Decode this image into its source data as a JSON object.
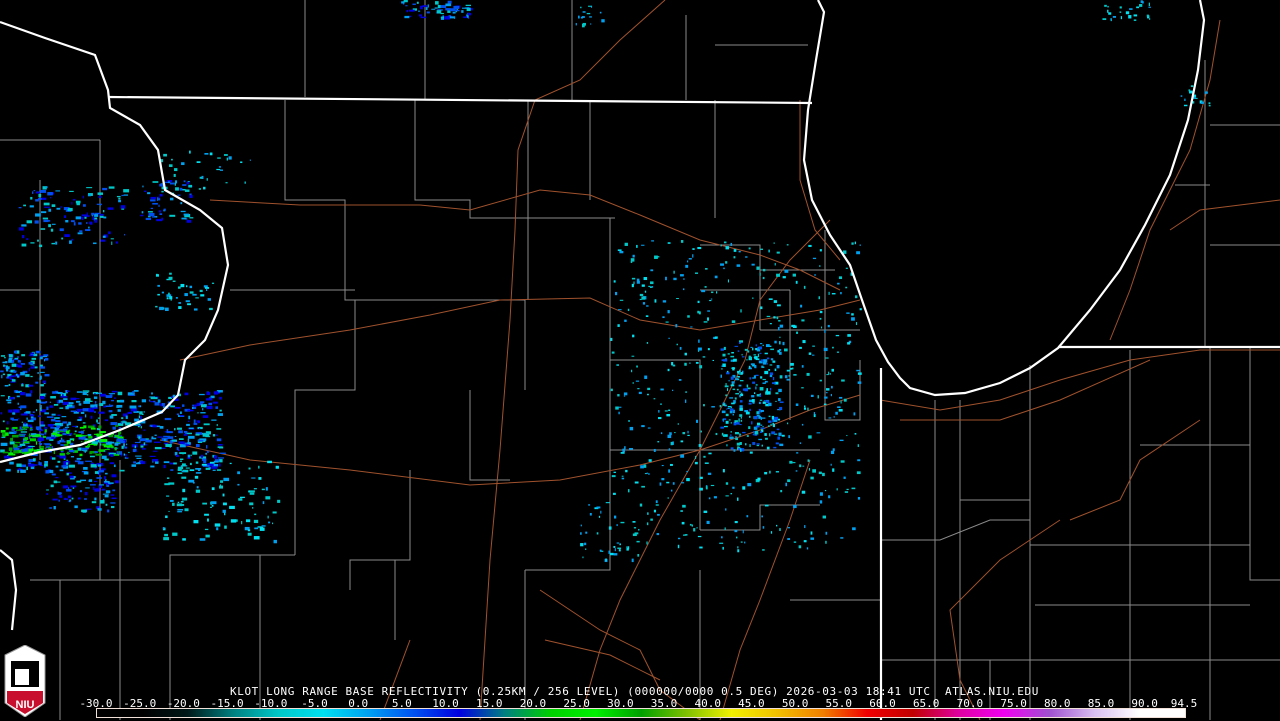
{
  "product": {
    "title": "KLOT LONG RANGE BASE REFLECTIVITY (0.25KM / 256 LEVEL) (000000/0000 0.5 DEG) 2026-03-03 18:41 UTC  ATLAS.NIU.EDU"
  },
  "colorbar": {
    "ticks": [
      "-30.0",
      "-25.0",
      "-20.0",
      "-15.0",
      "-10.0",
      "-5.0",
      "0.0",
      "5.0",
      "10.0",
      "15.0",
      "20.0",
      "25.0",
      "30.0",
      "35.0",
      "40.0",
      "45.0",
      "50.0",
      "55.0",
      "60.0",
      "65.0",
      "70.0",
      "75.0",
      "80.0",
      "85.0",
      "90.0",
      "94.5"
    ],
    "min": -30.0,
    "max": 94.5,
    "colors": [
      "#000000",
      "#000000",
      "#001818",
      "#008080",
      "#00c8c8",
      "#00e0f0",
      "#00a0f0",
      "#0050f0",
      "#0000e0",
      "#008080",
      "#00d000",
      "#00f000",
      "#00a000",
      "#80c000",
      "#f0f000",
      "#f0c000",
      "#f08000",
      "#f00000",
      "#c00000",
      "#e000a0",
      "#f000f0",
      "#a050d0",
      "#d8c0f0",
      "#ffffff",
      "#ffffff"
    ]
  },
  "logo": {
    "text": "NIU",
    "accent": "#c8102e"
  },
  "map_colors": {
    "state": "#ffffff",
    "county": "#8c8c8c",
    "road": "#a0522d"
  }
}
